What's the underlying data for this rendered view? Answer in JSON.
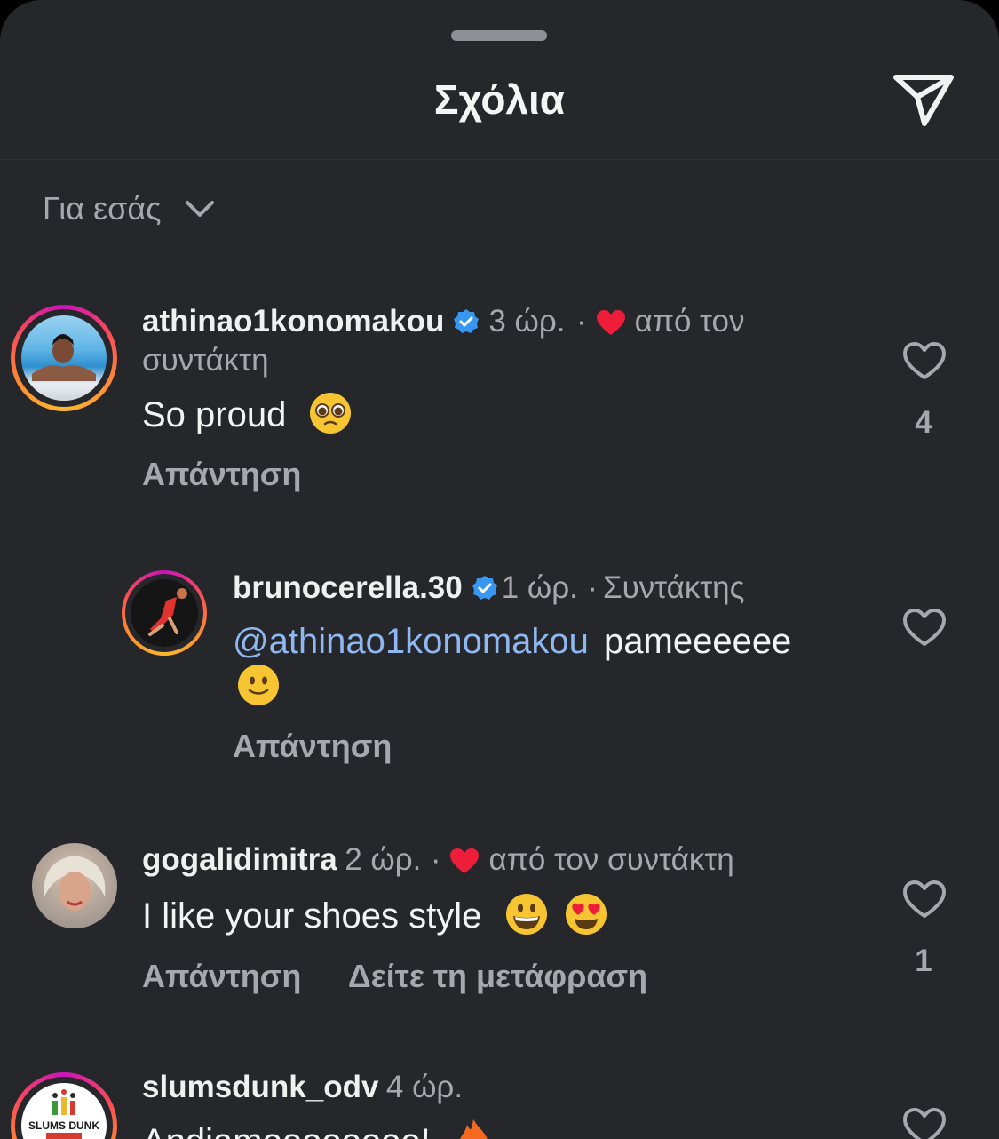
{
  "header": {
    "title": "Σχόλια",
    "send_icon": "send-icon"
  },
  "sort": {
    "label": "Για εσάς",
    "icon": "chevron-down-icon"
  },
  "comments": [
    {
      "username": "athinao1konomakou",
      "verified": true,
      "time": "3 ώρ.",
      "separator": "·",
      "creator_like_text": "από τον",
      "creator_like_text_2": "συντάκτη",
      "text": "So proud",
      "reply_label": "Απάντηση",
      "likes": "4"
    },
    {
      "username": "brunocerella.30",
      "verified": true,
      "time": "1 ώρ.",
      "separator": "·",
      "author_badge": "Συντάκτης",
      "mention": "@athinao1konomakou",
      "text": "pameeeeee",
      "reply_label": "Απάντηση"
    },
    {
      "username": "gogalidimitra",
      "time": "2 ώρ.",
      "separator": "·",
      "creator_like_text": "από τον συντάκτη",
      "text": "I like your shoes style",
      "reply_label": "Απάντηση",
      "translate_label": "Δείτε τη μετάφραση",
      "likes": "1"
    },
    {
      "username": "slumsdunk_odv",
      "time": "4 ώρ.",
      "text": "Andiamoooooooo!",
      "avatar_logo_text": "SLUMS DUNK"
    }
  ],
  "colors": {
    "background": "#25272b",
    "heart_red": "#ee1d3a",
    "mention": "#8fb8f2",
    "verified": "#3897f0"
  }
}
